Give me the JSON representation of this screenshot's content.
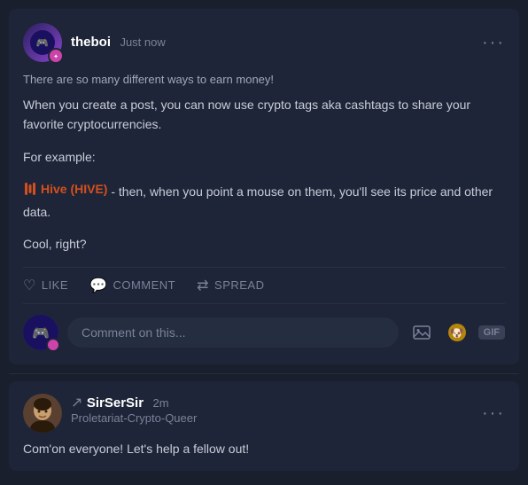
{
  "post": {
    "author": {
      "username": "theboi",
      "timestamp": "Just now",
      "badge_color": "#cc44aa"
    },
    "subtitle": "There are so many different ways to earn money!",
    "body": {
      "paragraph1": "When you create a post, you can now use crypto tags aka cashtags to share your favorite cryptocurrencies.",
      "example_label": "For example:",
      "hive_tag": "Hive (HIVE)",
      "hive_suffix": " - then, when you point a mouse on them, you'll see its price and other data.",
      "paragraph3": "Cool, right?"
    },
    "actions": {
      "like": "LIKE",
      "comment": "COMMENT",
      "spread": "SPREAD"
    },
    "comment_input": {
      "placeholder": "Comment on this..."
    }
  },
  "comment": {
    "author": {
      "username": "SirSerSir",
      "timestamp": "2m",
      "role": "Proletariat-Crypto-Queer"
    },
    "body": "Com'on everyone! Let's help a fellow out!",
    "more_label": "···"
  },
  "more_label": "···"
}
